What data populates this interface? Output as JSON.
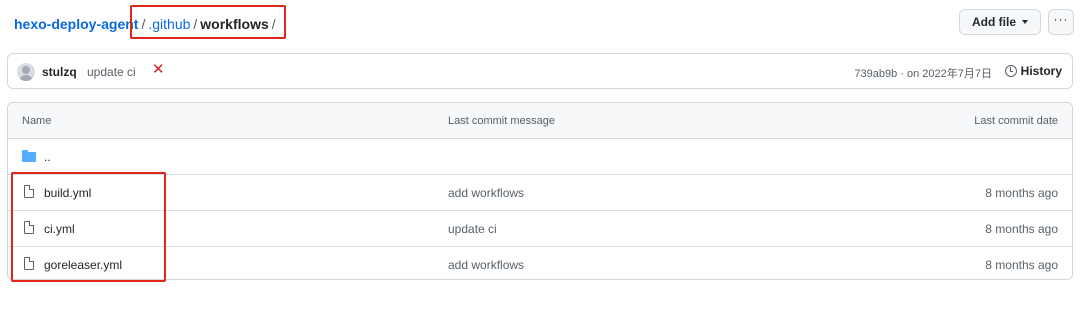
{
  "breadcrumb": {
    "repo": "hexo-deploy-agent",
    "sep1": "/",
    "dir1": ".github",
    "sep2": "/",
    "current": "workflows",
    "sep3": "/"
  },
  "toolbar": {
    "add_file_label": "Add file",
    "more_label": "···"
  },
  "latest_commit": {
    "author": "stulzq",
    "message": "update ci",
    "status_symbol": "✕",
    "status_color": "#cf222e",
    "sha_date": "739ab9b · on 2022年7月7日",
    "history_label": "History"
  },
  "table": {
    "headers": {
      "name": "Name",
      "message": "Last commit message",
      "date": "Last commit date"
    },
    "parent_dir": "..",
    "rows": [
      {
        "name": "build.yml",
        "message": "add workflows",
        "date": "8 months ago"
      },
      {
        "name": "ci.yml",
        "message": "update ci",
        "date": "8 months ago"
      },
      {
        "name": "goreleaser.yml",
        "message": "add workflows",
        "date": "8 months ago"
      }
    ]
  },
  "colors": {
    "link": "#0969da",
    "highlight": "#e0261b",
    "folder": "#54aeff"
  }
}
